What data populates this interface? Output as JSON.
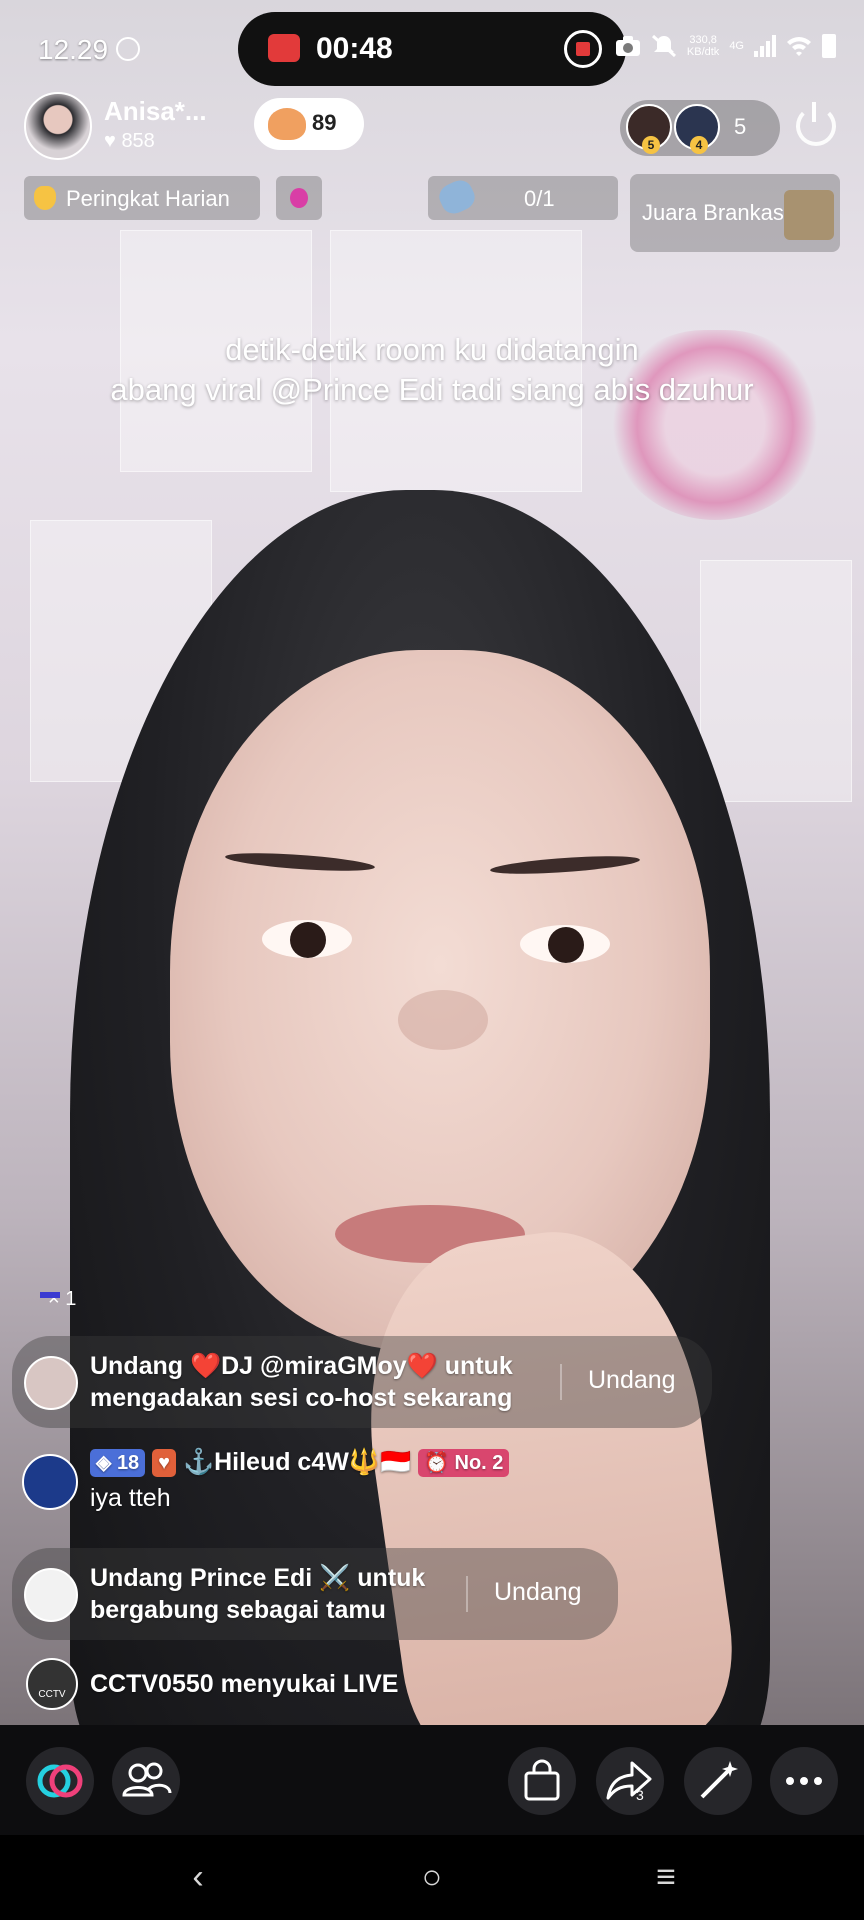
{
  "status_bar": {
    "time": "12.29",
    "recording_time": "00:48",
    "net_speed": "330,8\nKB/dtk",
    "network_type": "4G",
    "icons": [
      "whatsapp-icon",
      "camera-icon",
      "mute-icon",
      "signal-icon",
      "wifi-icon",
      "battery-icon"
    ]
  },
  "host": {
    "name": "Anisa*...",
    "likes": "858",
    "follow_count": "89"
  },
  "viewers": {
    "top_badges": [
      "5",
      "4"
    ],
    "count": "5"
  },
  "ranking": {
    "label": "Peringkat Harian"
  },
  "goal": {
    "progress": "0/1"
  },
  "treasure": {
    "label": "Juara Brankas"
  },
  "caption": {
    "line1": "detik-detik room ku didatangin",
    "line2": "abang viral @Prince Edi tadi siang abis dzuhur"
  },
  "combo": {
    "text": "× 1"
  },
  "chat": {
    "invite_cohost": {
      "line1": "Undang ❤️DJ @miraGMoy❤️ untuk",
      "line2": "mengadakan sesi co-host sekarang",
      "action": "Undang"
    },
    "message": {
      "level": "18",
      "username": "⚓Hileud c4W🔱🇮🇩",
      "rank": "No. 2",
      "text": "iya tteh"
    },
    "invite_guest": {
      "line1": "Undang Prince Edi ⚔️ untuk",
      "line2": "bergabung sebagai tamu",
      "action": "Undang"
    },
    "like_event": {
      "text": "CCTV0550 menyukai LIVE",
      "avatar_label": "CCTV"
    }
  },
  "toolbar": {
    "share_count": "3",
    "icons": [
      "link-icon",
      "guests-icon",
      "shop-bag-icon",
      "share-icon",
      "magic-wand-icon",
      "more-icon"
    ]
  },
  "colors": {
    "toolbar_bg": "#0d0d0f",
    "chat_pill_bg": "rgba(60,60,60,0.4)",
    "accent_orange": "#f0a060",
    "record_red": "#e23a3a"
  }
}
